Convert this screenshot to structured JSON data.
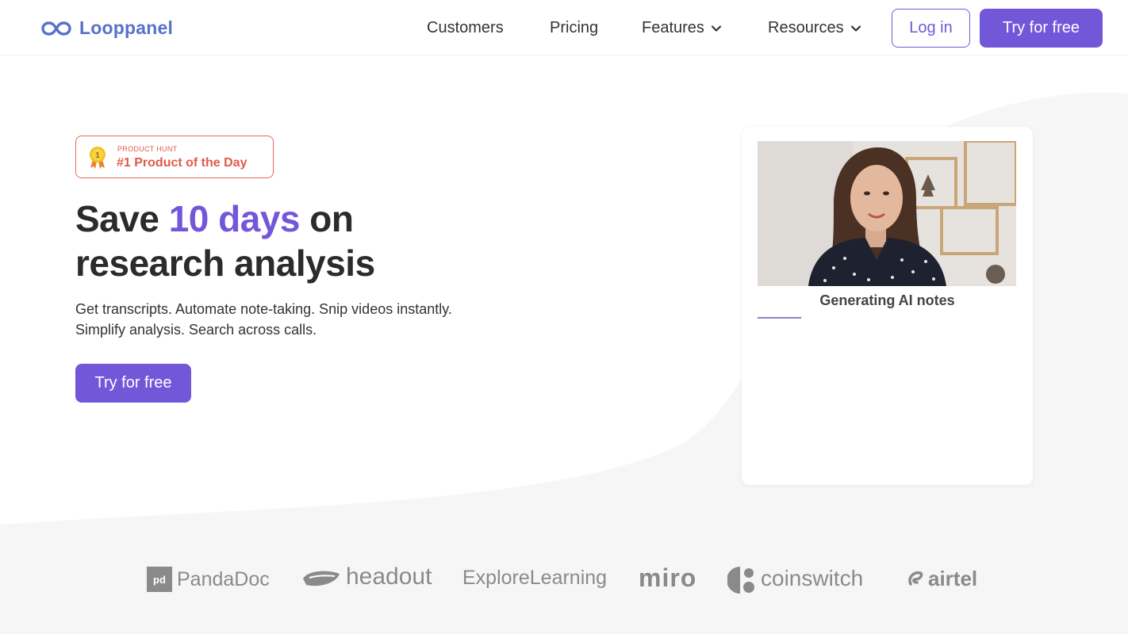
{
  "header": {
    "logo_text": "Looppanel",
    "nav": {
      "customers": "Customers",
      "pricing": "Pricing",
      "features": "Features",
      "resources": "Resources"
    },
    "login_label": "Log in",
    "try_label": "Try for free"
  },
  "hero": {
    "badge_small": "PRODUCT HUNT",
    "badge_big": "#1 Product of the Day",
    "title_part1": "Save ",
    "title_accent": "10 days",
    "title_part2": " on",
    "title_line2": "research analysis",
    "subtitle_line1": "Get transcripts. Automate note-taking. Snip videos instantly.",
    "subtitle_line2": "Simplify analysis. Search across calls.",
    "cta_label": "Try for free"
  },
  "card": {
    "label": "Generating AI notes",
    "progress": 0.17
  },
  "logos": [
    "PandaDoc",
    "headout",
    "ExploreLearning",
    "miro",
    "coinswitch",
    "airtel"
  ],
  "colors": {
    "accent": "#7357d9",
    "logo_blue": "#5872c8",
    "badge_red": "#e05a48"
  }
}
